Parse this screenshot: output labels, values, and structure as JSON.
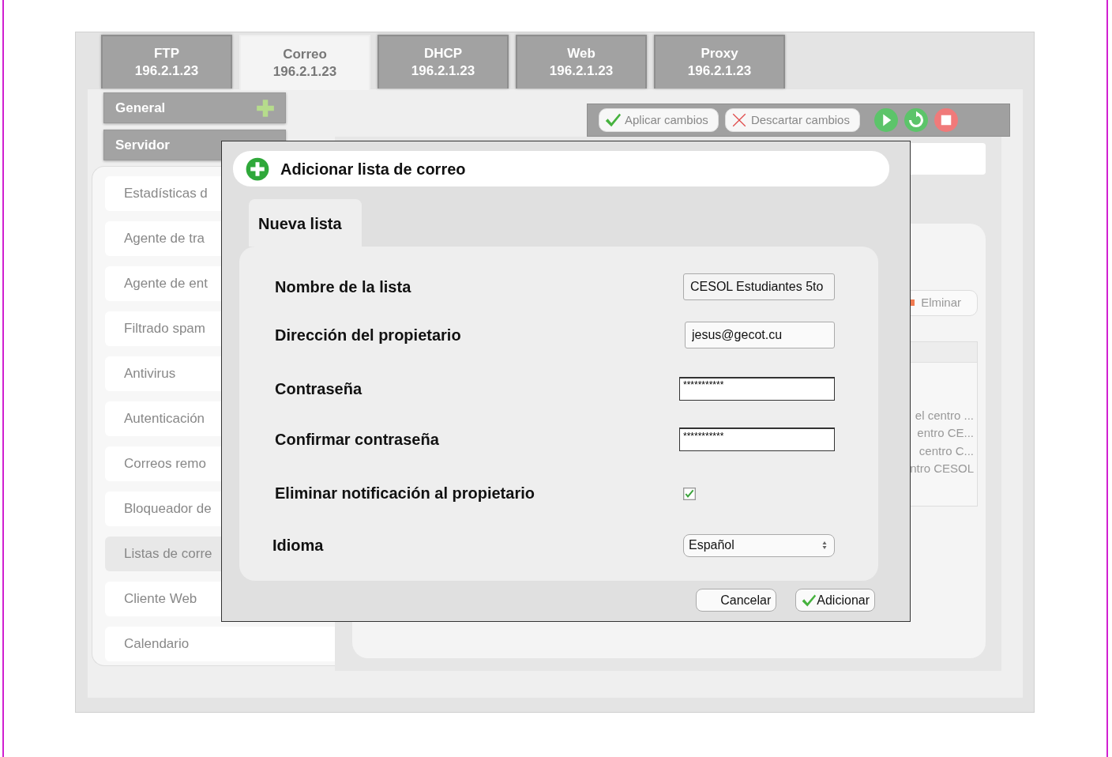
{
  "tabs": [
    {
      "title": "FTP",
      "address": "196.2.1.23",
      "selected": false
    },
    {
      "title": "Correo",
      "address": "196.2.1.23",
      "selected": true
    },
    {
      "title": "DHCP",
      "address": "196.2.1.23",
      "selected": false
    },
    {
      "title": "Web",
      "address": "196.2.1.23",
      "selected": false
    },
    {
      "title": "Proxy",
      "address": "196.2.1.23",
      "selected": false
    }
  ],
  "sidebar": {
    "sections": [
      {
        "label": "General"
      },
      {
        "label": "Servidor"
      }
    ],
    "items": [
      {
        "label": "Estadísticas d",
        "selected": false
      },
      {
        "label": "Agente de tra",
        "selected": false
      },
      {
        "label": "Agente de ent",
        "selected": false
      },
      {
        "label": "Filtrado spam",
        "selected": false
      },
      {
        "label": "Antivirus",
        "selected": false
      },
      {
        "label": "Autenticación",
        "selected": false
      },
      {
        "label": "Correos remo",
        "selected": false
      },
      {
        "label": "Bloqueador de",
        "selected": false
      },
      {
        "label": "Listas de corre",
        "selected": true
      },
      {
        "label": "Cliente Web",
        "selected": false
      },
      {
        "label": "Calendario",
        "selected": false
      }
    ]
  },
  "toolbar": {
    "buttons": [
      {
        "label": "Aplicar cambios",
        "kind": "apply"
      },
      {
        "label": "Descartar cambios",
        "kind": "discard"
      }
    ]
  },
  "content": {
    "delete_button": "Elminar",
    "rows": [
      "el centro ...",
      "entro CE...",
      "centro C...",
      "ntro CESOL"
    ]
  },
  "dialog": {
    "title": "Adicionar lista de correo",
    "tab": "Nueva lista",
    "fields": [
      {
        "label": "Nombre de la lista",
        "kind": "text",
        "value": "CESOL Estudiantes 5to"
      },
      {
        "label": "Dirección del propietario",
        "kind": "text",
        "value": "jesus@gecot.cu"
      },
      {
        "label": "Contraseña",
        "kind": "password",
        "value": "***********"
      },
      {
        "label": "Confirmar contraseña",
        "kind": "password",
        "value": "***********"
      },
      {
        "label": "Eliminar notificación al propietario",
        "kind": "checkbox",
        "checked": true
      },
      {
        "label": "Idioma",
        "kind": "select",
        "value": "Español"
      }
    ],
    "buttons": [
      {
        "label": "Cancelar",
        "kind": "cancel"
      },
      {
        "label": "Adicionar",
        "kind": "confirm"
      }
    ]
  }
}
